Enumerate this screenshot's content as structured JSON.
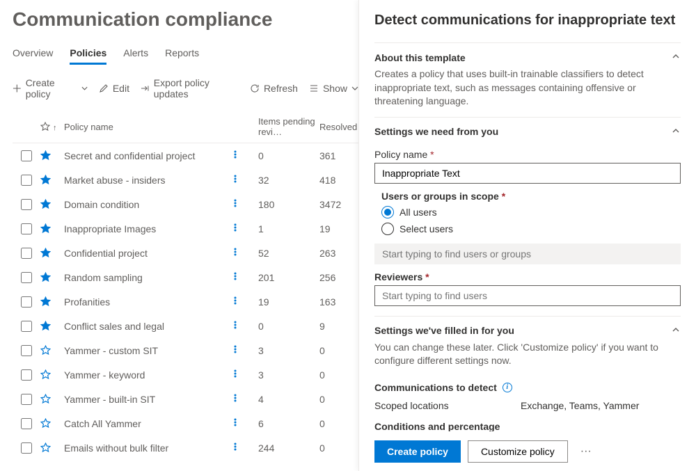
{
  "page": {
    "title": "Communication compliance"
  },
  "tabs": {
    "items": [
      "Overview",
      "Policies",
      "Alerts",
      "Reports"
    ],
    "active": 1
  },
  "toolbar": {
    "create": "Create policy",
    "edit": "Edit",
    "export": "Export policy updates",
    "refresh": "Refresh",
    "show": "Show"
  },
  "table": {
    "headers": {
      "name": "Policy name",
      "pending": "Items pending revi…",
      "resolved": "Resolved"
    },
    "rows": [
      {
        "starred": true,
        "name": "Secret and confidential project",
        "pending": "0",
        "resolved": "361"
      },
      {
        "starred": true,
        "name": "Market abuse - insiders",
        "pending": "32",
        "resolved": "418"
      },
      {
        "starred": true,
        "name": "Domain condition",
        "pending": "180",
        "resolved": "3472"
      },
      {
        "starred": true,
        "name": "Inappropriate Images",
        "pending": "1",
        "resolved": "19"
      },
      {
        "starred": true,
        "name": "Confidential project",
        "pending": "52",
        "resolved": "263"
      },
      {
        "starred": true,
        "name": "Random sampling",
        "pending": "201",
        "resolved": "256"
      },
      {
        "starred": true,
        "name": "Profanities",
        "pending": "19",
        "resolved": "163"
      },
      {
        "starred": true,
        "name": "Conflict sales and legal",
        "pending": "0",
        "resolved": "9"
      },
      {
        "starred": false,
        "name": "Yammer - custom SIT",
        "pending": "3",
        "resolved": "0"
      },
      {
        "starred": false,
        "name": "Yammer - keyword",
        "pending": "3",
        "resolved": "0"
      },
      {
        "starred": false,
        "name": "Yammer - built-in SIT",
        "pending": "4",
        "resolved": "0"
      },
      {
        "starred": false,
        "name": "Catch All Yammer",
        "pending": "6",
        "resolved": "0"
      },
      {
        "starred": false,
        "name": "Emails without bulk filter",
        "pending": "244",
        "resolved": "0"
      }
    ]
  },
  "panel": {
    "title": "Detect communications for inappropriate text",
    "about": {
      "heading": "About this template",
      "desc": "Creates a policy that uses built-in trainable classifiers to detect inappropriate text, such as messages containing offensive or threatening language."
    },
    "settings": {
      "heading": "Settings we need from you",
      "policy_name_label": "Policy name",
      "policy_name_value": "Inappropriate Text",
      "scope_label": "Users or groups in scope",
      "scope_options": {
        "all": "All users",
        "select": "Select users"
      },
      "scope_placeholder": "Start typing to find users or groups",
      "reviewers_label": "Reviewers",
      "reviewers_placeholder": "Start typing to find users"
    },
    "filled": {
      "heading": "Settings we've filled in for you",
      "desc": "You can change these later. Click 'Customize policy' if you want to configure different settings now.",
      "comm_detect": "Communications to detect",
      "scoped_locations_k": "Scoped locations",
      "scoped_locations_v": "Exchange, Teams, Yammer",
      "conditions": "Conditions and percentage"
    },
    "footer": {
      "create": "Create policy",
      "customize": "Customize policy"
    }
  }
}
